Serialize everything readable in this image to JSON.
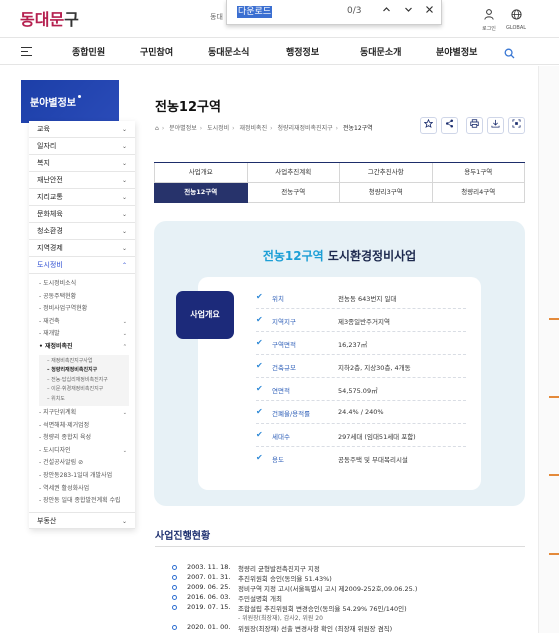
{
  "header": {
    "logo_main": "동대문",
    "logo_sub": "구",
    "cut_text": "동대",
    "login_label": "로그인",
    "global_label": "GLOBAL"
  },
  "find_bar": {
    "query": "다운로드",
    "count": "0/3",
    "up_icon": "chevron-up-icon",
    "down_icon": "chevron-down-icon",
    "close_icon": "close-icon"
  },
  "gnb": {
    "items": [
      "종합민원",
      "구민참여",
      "동대문소식",
      "행정정보",
      "동대문소개",
      "분야별정보"
    ]
  },
  "lnb": {
    "title": "분야별정보",
    "items": [
      {
        "label": "교육",
        "chev": "⌄"
      },
      {
        "label": "일자리",
        "chev": "⌄"
      },
      {
        "label": "복지",
        "chev": "⌄"
      },
      {
        "label": "재난안전",
        "chev": "⌄"
      },
      {
        "label": "지리교통",
        "chev": "⌄"
      },
      {
        "label": "문화체육",
        "chev": "⌄"
      },
      {
        "label": "청소환경",
        "chev": "⌄"
      },
      {
        "label": "지역경제",
        "chev": "⌄"
      },
      {
        "label": "도시정비",
        "chev": "⌃"
      }
    ],
    "sub_items": [
      {
        "label": "도시정비소식",
        "chev": ""
      },
      {
        "label": "공동주택현황",
        "chev": ""
      },
      {
        "label": "정비사업구역현황",
        "chev": ""
      },
      {
        "label": "재건축",
        "chev": "⌄"
      },
      {
        "label": "재개발",
        "chev": "⌄"
      },
      {
        "label": "재정비촉진",
        "chev": "⌃"
      }
    ],
    "sub3_items": [
      "재정비촉진지구사업",
      "청량리재정비촉진지구",
      "전농·답십리재정비촉진지구",
      "이문·휘경재정비촉진지구",
      "위치도"
    ],
    "sub_items_after": [
      {
        "label": "지구단위계획",
        "chev": "⌄"
      },
      {
        "label": "석면해체·제거업정",
        "chev": ""
      },
      {
        "label": "청량리 종합지 육성",
        "chev": ""
      },
      {
        "label": "도시디자인",
        "chev": "⌄"
      },
      {
        "label": "건설공사알림 ⊘",
        "chev": ""
      },
      {
        "label": "장안동283-1일대 개발사업",
        "chev": ""
      },
      {
        "label": "역세권 활성화사업",
        "chev": ""
      },
      {
        "label": "장안동 일대 종합발전계획 수립",
        "chev": ""
      }
    ],
    "last_item": {
      "label": "부동산",
      "chev": "⌄"
    }
  },
  "page": {
    "title": "전농12구역",
    "breadcrumb": [
      "⌂",
      "분야별정보",
      "도시정비",
      "재정비촉진",
      "청량리재정비촉진지구",
      "전농12구역"
    ],
    "util_icons": [
      "star-icon",
      "share-icon",
      "print-icon",
      "download-icon",
      "qr-icon"
    ]
  },
  "tabs": [
    [
      {
        "label": "사업개요",
        "active": false
      },
      {
        "label": "사업추진계획",
        "active": false
      },
      {
        "label": "그간추진사항",
        "active": false
      },
      {
        "label": "용두1구역",
        "active": false
      }
    ],
    [
      {
        "label": "전농12구역",
        "active": true
      },
      {
        "label": "전농구역",
        "active": false
      },
      {
        "label": "청량리3구역",
        "active": false
      },
      {
        "label": "청량리4구역",
        "active": false
      }
    ]
  ],
  "overview": {
    "title_highlight": "전농12구역",
    "title_rest": " 도시환경정비사업",
    "badge": "사업개요",
    "rows": [
      {
        "key": "위치",
        "value": "전농동 643번지 일대"
      },
      {
        "key": "지역지구",
        "value": "제3종일반주거지역"
      },
      {
        "key": "구역면적",
        "value": "16,237㎡"
      },
      {
        "key": "건축규모",
        "value": "지하2층, 지상30층, 4개동"
      },
      {
        "key": "연면적",
        "value": "54,575.09㎡"
      },
      {
        "key": "건폐율/용적률",
        "value": "24.4% / 240%"
      },
      {
        "key": "세대수",
        "value": "297세대 (임대51세대 포함)"
      },
      {
        "key": "용도",
        "value": "공동주택 및 부대복리시설"
      }
    ]
  },
  "progress": {
    "title": "사업진행현황",
    "items": [
      {
        "date": "2003. 11. 18.",
        "text": "청량리 균형발전촉진지구 지정"
      },
      {
        "date": "2007. 01. 31.",
        "text": "추진위원회 승인(동의율 51.43%)"
      },
      {
        "date": "2009. 06. 25.",
        "text": "정비구역 지정 고시(서울특별시 고시 제2009-252호,09.06.25.)"
      },
      {
        "date": "2016. 06. 03.",
        "text": "주민설명회 개최"
      },
      {
        "date": "2019. 07. 15.",
        "text": "조합설립 추진위원회 변경승인(동의율 54.29% 76인/140인)"
      }
    ],
    "sub_note": "- 위원장(최장재), 감사2, 위원 20",
    "cut_date": "2020. 01. 00.",
    "cut_text": "위원장(최장재) 선출 변경사항 확인 (최장재 위원장 겸직)"
  }
}
